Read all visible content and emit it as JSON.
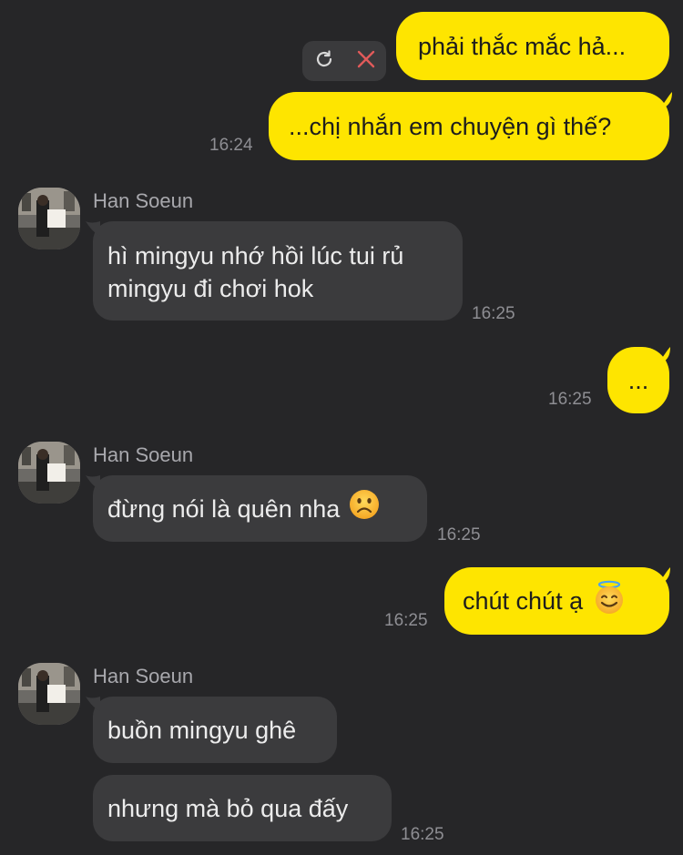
{
  "conversation": {
    "contact_name": "Han Soeun",
    "messages": {
      "m1": {
        "text": "phải thắc mắc hả...",
        "sender": "me"
      },
      "m2": {
        "text": "...chị nhắn em chuyện gì thế?",
        "sender": "me",
        "time": "16:24"
      },
      "m3": {
        "text": "hì mingyu nhớ hồi lúc tui rủ mingyu đi chơi hok",
        "sender": "Han Soeun",
        "time": "16:25"
      },
      "m4": {
        "text": "...",
        "sender": "me",
        "time": "16:25"
      },
      "m5": {
        "text": "đừng nói là quên nha",
        "sender": "Han Soeun",
        "time": "16:25",
        "emoji": "frowning-face"
      },
      "m6": {
        "text": "chút chút ạ",
        "sender": "me",
        "time": "16:25",
        "emoji": "smiling-face-with-halo"
      },
      "m7": {
        "text": "buồn mingyu ghê",
        "sender": "Han Soeun"
      },
      "m8": {
        "text": "nhưng mà bỏ qua đấy",
        "sender": "Han Soeun",
        "time": "16:25"
      }
    }
  },
  "failed_message_actions": {
    "retry_icon": "refresh-icon",
    "delete_icon": "close-icon"
  },
  "colors": {
    "background": "#262628",
    "my_bubble": "#FEE500",
    "their_bubble": "#3b3b3d",
    "delete_icon": "#e05a5a"
  }
}
